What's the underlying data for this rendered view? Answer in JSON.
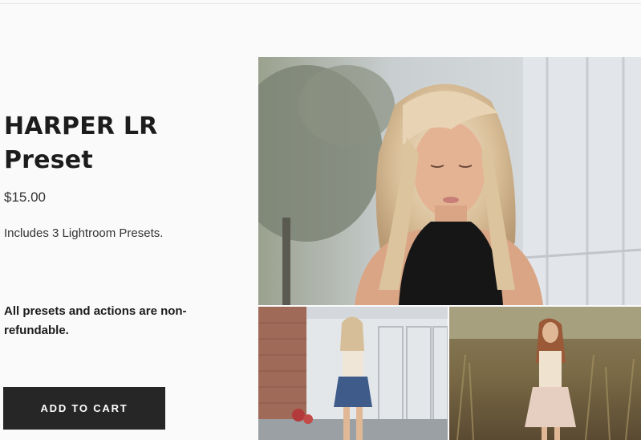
{
  "product": {
    "title": "HARPER LR Preset",
    "price": "$15.00",
    "description": "Includes 3 Lightroom Presets.",
    "note": "All presets and actions are non-refundable.",
    "add_to_cart_label": "ADD TO CART"
  },
  "gallery": {
    "images": [
      {
        "name": "main-product-photo",
        "alt": "Woman with blonde hair in black top"
      },
      {
        "name": "thumbnail-photo-1",
        "alt": "Woman in lace top and denim skirt by a wall"
      },
      {
        "name": "thumbnail-photo-2",
        "alt": "Woman in lace dress in a field"
      }
    ]
  },
  "colors": {
    "button_bg": "#262626",
    "button_text": "#ffffff",
    "page_bg": "#fafafa"
  }
}
